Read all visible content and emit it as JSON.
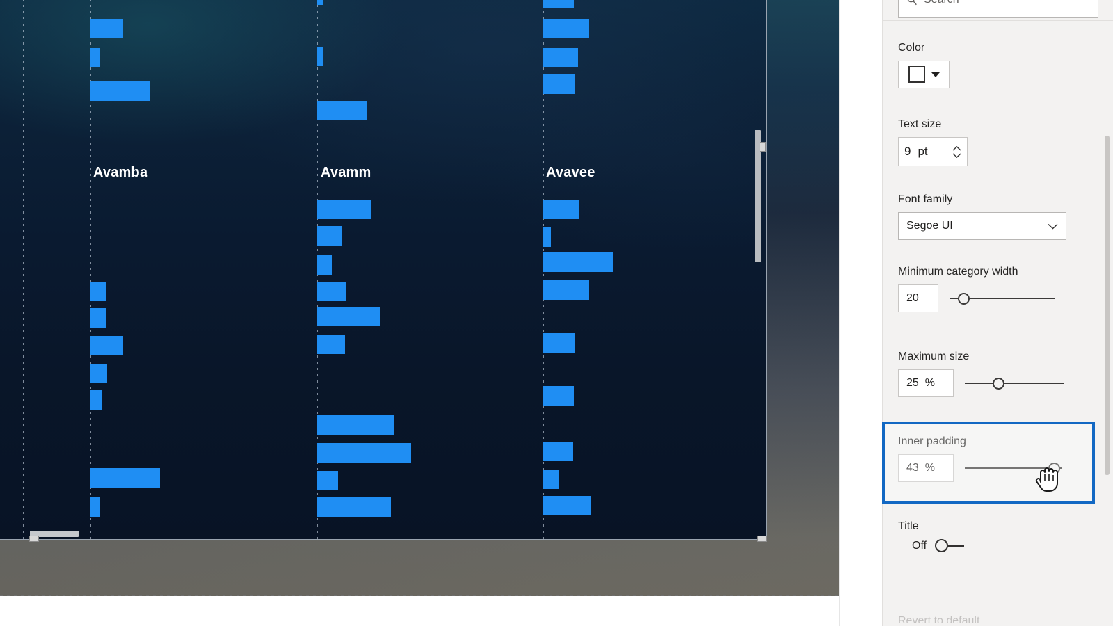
{
  "report": {
    "visual_type": "clustered-bar-chart",
    "categories": [
      "Avamba",
      "Avamm",
      "Avavee"
    ],
    "bar_color": "#1f8ef3",
    "plot_background": "#0a1a30"
  },
  "chart_data": {
    "type": "bar",
    "orientation": "horizontal",
    "title": "",
    "xlabel": "",
    "ylabel": "",
    "categories": [
      "Avamba",
      "Avamm",
      "Avavee"
    ],
    "grid": true,
    "legend_position": "none",
    "series": [
      {
        "name": "Avamba",
        "group_label": "Avamba",
        "values": [
          47,
          14,
          85,
          23,
          22,
          47,
          24,
          17,
          100,
          14
        ]
      },
      {
        "name": "Avamm",
        "group_label": "Avamm",
        "values": [
          9,
          72,
          78,
          36,
          21,
          42,
          90,
          40,
          122,
          135,
          30,
          106
        ]
      },
      {
        "name": "Avavee",
        "group_label": "Avavee",
        "values": [
          44,
          66,
          50,
          46,
          51,
          11,
          100,
          66,
          45,
          44,
          43,
          23,
          68
        ]
      }
    ]
  },
  "format_pane": {
    "search": {
      "placeholder": "Search",
      "icon": "search-icon"
    },
    "color": {
      "label": "Color",
      "swatch_value": "#ffffff"
    },
    "text_size": {
      "label": "Text size",
      "value": "9",
      "unit": "pt"
    },
    "font_family": {
      "label": "Font family",
      "value": "Segoe UI"
    },
    "minimum_category_width": {
      "label": "Minimum category width",
      "value": "20",
      "slider_percent": 12
    },
    "maximum_size": {
      "label": "Maximum size",
      "value": "25",
      "unit": "%",
      "slider_percent": 33
    },
    "inner_padding": {
      "label": "Inner padding",
      "value": "43",
      "unit": "%",
      "slider_percent": 86,
      "highlighted": true
    },
    "title": {
      "label": "Title",
      "state_label": "Off",
      "state": false
    },
    "footer_cut_text": "Revert to default"
  },
  "colors": {
    "accent_highlight": "#1268c3",
    "pane_background": "#f3f2f1",
    "bar": "#1f8ef3"
  }
}
